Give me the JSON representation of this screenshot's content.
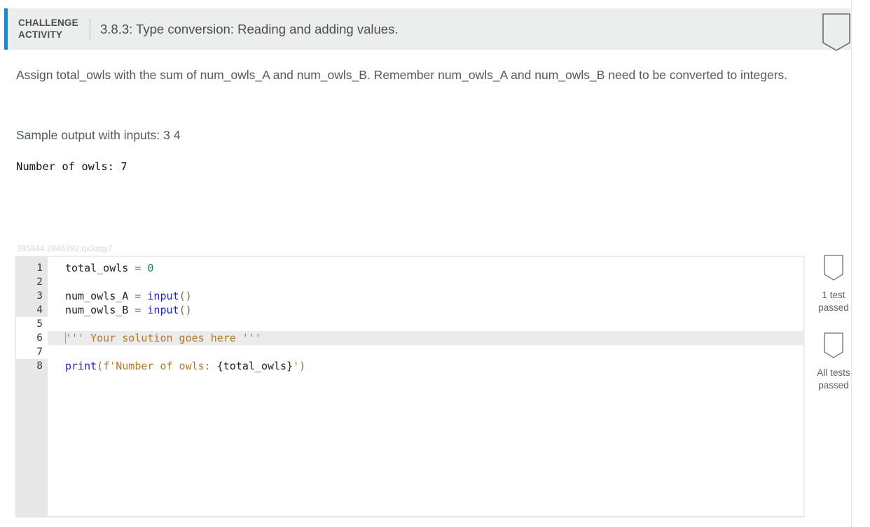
{
  "header": {
    "label": "CHALLENGE\nACTIVITY",
    "title": "3.8.3: Type conversion: Reading and adding values.",
    "ribbon_icon": "ribbon-icon",
    "accent_color": "#1f86c8",
    "background_color": "#eceded"
  },
  "instructions": {
    "paragraph": "Assign total_owls with the sum of num_owls_A and num_owls_B. Remember num_owls_A and num_owls_B need to be converted to integers.",
    "sample_label": "Sample output with inputs: 3 4",
    "sample_output": "Number of owls: 7"
  },
  "watermark": {
    "id": "395644.2845392.qx3zqy7"
  },
  "editor": {
    "lines": [
      {
        "number": "1",
        "editable": false,
        "highlight": false,
        "tokens": [
          {
            "text": "total_owls",
            "cls": "t-id"
          },
          {
            "text": " ",
            "cls": "t-op"
          },
          {
            "text": "=",
            "cls": "t-op"
          },
          {
            "text": " ",
            "cls": "t-op"
          },
          {
            "text": "0",
            "cls": "t-num"
          }
        ]
      },
      {
        "number": "2",
        "editable": false,
        "highlight": false,
        "tokens": []
      },
      {
        "number": "3",
        "editable": false,
        "highlight": false,
        "tokens": [
          {
            "text": "num_owls_A",
            "cls": "t-id"
          },
          {
            "text": " = ",
            "cls": "t-op"
          },
          {
            "text": "input",
            "cls": "t-fn"
          },
          {
            "text": "()",
            "cls": "t-punc"
          }
        ]
      },
      {
        "number": "4",
        "editable": false,
        "highlight": false,
        "tokens": [
          {
            "text": "num_owls_B",
            "cls": "t-id"
          },
          {
            "text": " = ",
            "cls": "t-op"
          },
          {
            "text": "input",
            "cls": "t-fn"
          },
          {
            "text": "()",
            "cls": "t-punc"
          }
        ]
      },
      {
        "number": "5",
        "editable": true,
        "highlight": false,
        "tokens": []
      },
      {
        "number": "6",
        "editable": true,
        "highlight": true,
        "caret": true,
        "tokens": [
          {
            "text": "''' Your solution goes here '''",
            "cls": "t-cmt"
          }
        ]
      },
      {
        "number": "7",
        "editable": true,
        "highlight": false,
        "tokens": []
      },
      {
        "number": "8",
        "editable": false,
        "highlight": false,
        "tokens": [
          {
            "text": "print",
            "cls": "t-fn"
          },
          {
            "text": "(",
            "cls": "t-punc"
          },
          {
            "text": "f'Number of owls: ",
            "cls": "t-str"
          },
          {
            "text": "{",
            "cls": "t-brace"
          },
          {
            "text": "total_owls",
            "cls": "t-id"
          },
          {
            "text": "}",
            "cls": "t-brace"
          },
          {
            "text": "'",
            "cls": "t-str"
          },
          {
            "text": ")",
            "cls": "t-punc"
          }
        ]
      }
    ]
  },
  "rail": {
    "badges": [
      {
        "icon": "ribbon-icon",
        "text": "1 test\npassed"
      },
      {
        "icon": "ribbon-icon",
        "text": "All tests\npassed"
      }
    ]
  }
}
